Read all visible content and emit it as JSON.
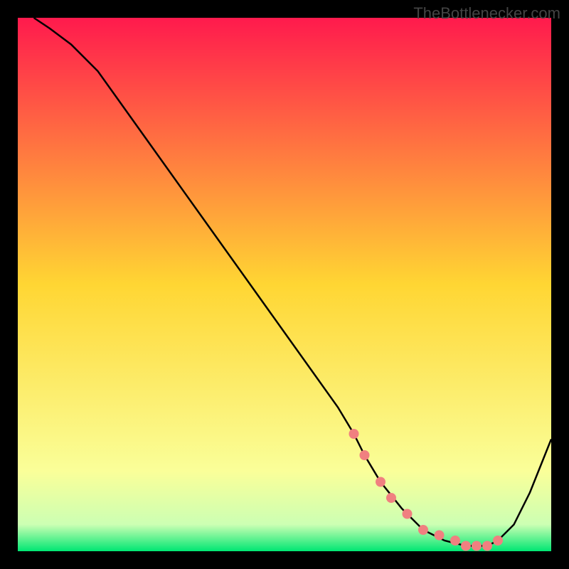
{
  "watermark": "TheBottlenecker.com",
  "chart_data": {
    "type": "line",
    "title": "",
    "xlabel": "",
    "ylabel": "",
    "xlim": [
      0,
      100
    ],
    "ylim": [
      0,
      100
    ],
    "background_gradient": {
      "stops": [
        {
          "offset": 0,
          "color": "#ff1a4d"
        },
        {
          "offset": 0.5,
          "color": "#ffd633"
        },
        {
          "offset": 0.85,
          "color": "#faff99"
        },
        {
          "offset": 0.95,
          "color": "#ccffb3"
        },
        {
          "offset": 1.0,
          "color": "#00e673"
        }
      ]
    },
    "series": [
      {
        "name": "curve",
        "type": "line",
        "color": "#000000",
        "x": [
          3,
          6,
          10,
          15,
          20,
          25,
          30,
          35,
          40,
          45,
          50,
          55,
          60,
          63,
          65,
          68,
          72,
          76,
          80,
          84,
          88,
          90,
          93,
          96,
          100
        ],
        "y": [
          100,
          98,
          95,
          90,
          83,
          76,
          69,
          62,
          55,
          48,
          41,
          34,
          27,
          22,
          18,
          13,
          8,
          4,
          2,
          1,
          1,
          2,
          5,
          11,
          21
        ]
      },
      {
        "name": "markers",
        "type": "scatter",
        "color": "#f08080",
        "x": [
          63,
          65,
          68,
          70,
          73,
          76,
          79,
          82,
          84,
          86,
          88,
          90
        ],
        "y": [
          22,
          18,
          13,
          10,
          7,
          4,
          3,
          2,
          1,
          1,
          1,
          2
        ]
      }
    ]
  }
}
